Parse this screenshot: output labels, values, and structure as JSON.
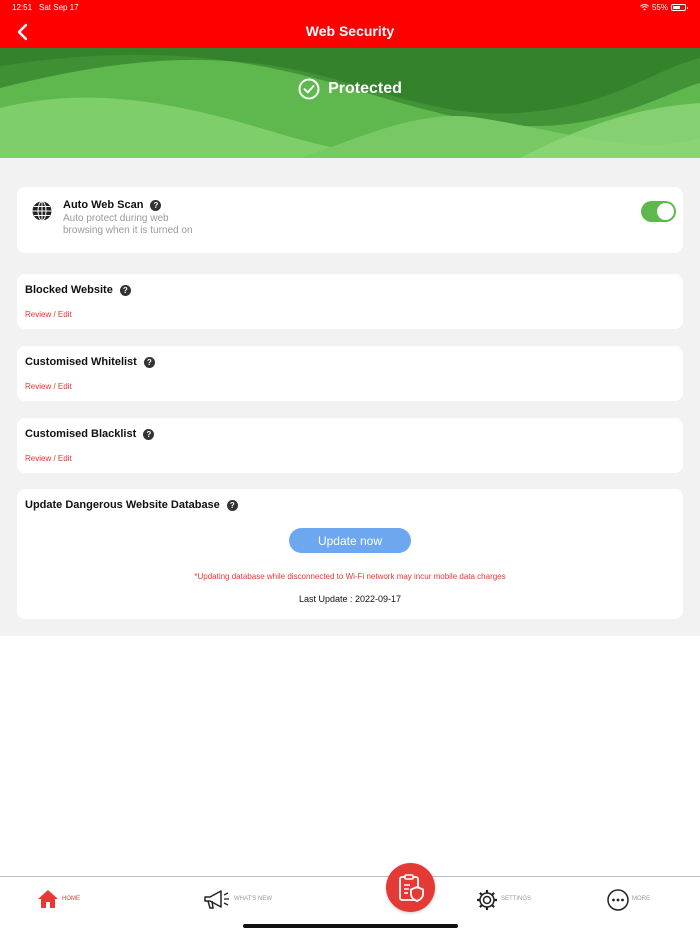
{
  "status_bar": {
    "time": "12:51",
    "date": "Sat Sep 17",
    "battery": "55%"
  },
  "header": {
    "title": "Web Security"
  },
  "banner": {
    "status": "Protected"
  },
  "auto_web_scan": {
    "title": "Auto Web Scan",
    "description": "Auto protect during web browsing when it is turned on",
    "enabled": true
  },
  "sections": [
    {
      "title": "Blocked Website",
      "link": "Review / Edit"
    },
    {
      "title": "Customised Whitelist",
      "link": "Review / Edit"
    },
    {
      "title": "Customised Blacklist",
      "link": "Review / Edit"
    }
  ],
  "database": {
    "title": "Update Dangerous Website Database",
    "button_label": "Update now",
    "warning": "*Updating database while disconnected to Wi-Fi network may incur mobile data charges",
    "last_update": "Last Update : 2022-09-17"
  },
  "tabbar": {
    "home": "HOME",
    "whats_new": "WHAT'S NEW",
    "settings": "SETTINGS",
    "more": "MORE"
  },
  "colors": {
    "header": "#ff0000",
    "accent": "#e53935",
    "banner_green": "#5fb84e",
    "button_blue": "#6da7ef"
  },
  "help_glyph": "?"
}
